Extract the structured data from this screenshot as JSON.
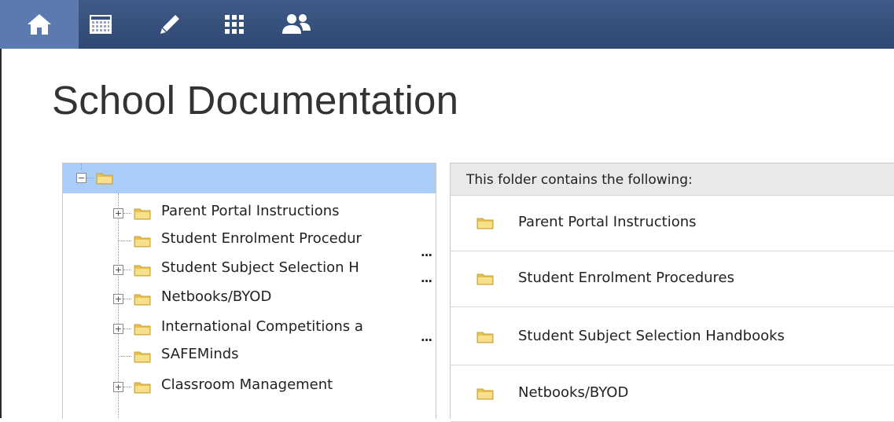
{
  "nav": {
    "items": [
      {
        "icon": "home-icon",
        "active": true
      },
      {
        "icon": "calendar-icon",
        "active": false
      },
      {
        "icon": "pencil-icon",
        "active": false
      },
      {
        "icon": "grid-icon",
        "active": false
      },
      {
        "icon": "people-icon",
        "active": false
      }
    ],
    "colors": {
      "bar": "#34507e",
      "active": "#5b7bb0"
    }
  },
  "page": {
    "title": "School Documentation"
  },
  "tree": {
    "root_label": "",
    "items": [
      {
        "label": "Parent Portal Instructions",
        "expandable": true,
        "truncated": false
      },
      {
        "label": "Student Enrolment Procedur",
        "expandable": false,
        "truncated": true
      },
      {
        "label": "Student Subject Selection H",
        "expandable": true,
        "truncated": true
      },
      {
        "label": "Netbooks/BYOD",
        "expandable": true,
        "truncated": false
      },
      {
        "label": "International Competitions a",
        "expandable": true,
        "truncated": true
      },
      {
        "label": "SAFEMinds",
        "expandable": false,
        "truncated": false
      },
      {
        "label": "Classroom Management",
        "expandable": true,
        "truncated": false
      }
    ],
    "ellipsis": "..."
  },
  "content": {
    "header": "This folder contains the following:",
    "items": [
      {
        "label": "Parent Portal Instructions"
      },
      {
        "label": "Student Enrolment Procedures"
      },
      {
        "label": "Student Subject Selection Handbooks"
      },
      {
        "label": "Netbooks/BYOD"
      }
    ]
  },
  "colors": {
    "selection": "#a9cdf6",
    "folder": "#f3d36b"
  }
}
